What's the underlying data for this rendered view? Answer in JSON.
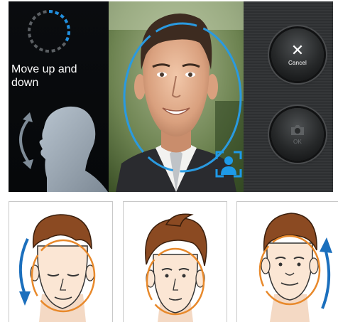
{
  "left_panel": {
    "instruction": "Move up and down",
    "progress_icon": "circular-progress-icon",
    "guide_icon": "head-nod-silhouette-icon"
  },
  "right_panel": {
    "cancel_label": "Cancel",
    "cancel_icon": "close-icon",
    "ok_label": "OK",
    "ok_icon": "camera-icon"
  },
  "camera": {
    "guide_color": "#2a9ae0",
    "detected_icon": "face-detect-person-icon"
  },
  "illustrations": [
    {
      "name": "tilt-down",
      "arrow_icon": "arrow-down-icon"
    },
    {
      "name": "face-forward"
    },
    {
      "name": "tilt-up",
      "arrow_icon": "arrow-up-icon"
    }
  ],
  "colors": {
    "accent_blue": "#2a9ae0",
    "guide_orange": "#e8892b",
    "hair_brown": "#8b4a22"
  }
}
